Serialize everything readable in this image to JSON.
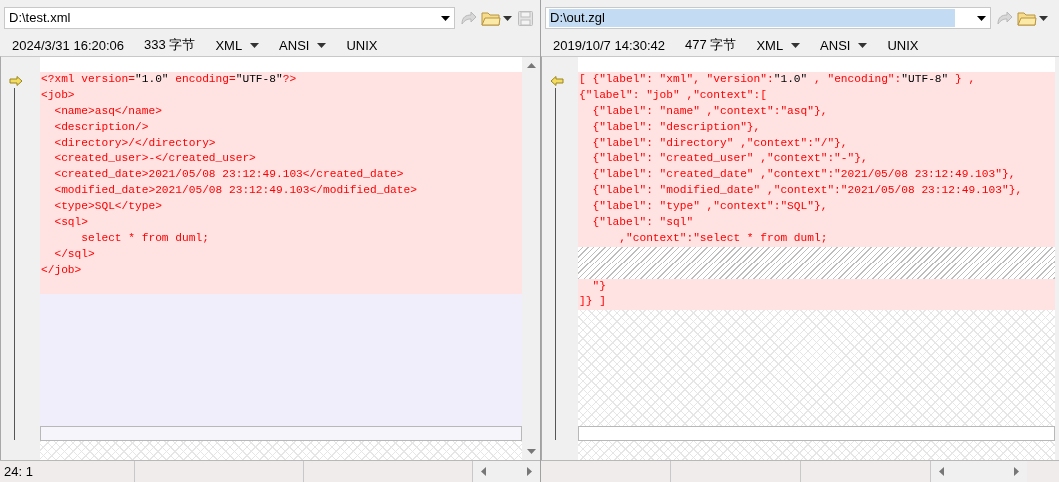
{
  "panes": [
    {
      "path": {
        "value": "D:\\test.xml",
        "selected": false
      },
      "info": {
        "date": "2024/3/31 16:20:06",
        "size": "333 字节",
        "syntax": "XML",
        "encoding": "ANSI",
        "eol": "UNIX"
      },
      "rows": [
        {
          "kind": "text",
          "segments": [
            {
              "text": "<?xml version=",
              "diff": true
            },
            {
              "text": "\"1.0\"",
              "diff": false
            },
            {
              "text": " encoding=",
              "diff": true
            },
            {
              "text": "\"UTF-8\"",
              "diff": false
            },
            {
              "text": "?>",
              "diff": true
            }
          ]
        },
        {
          "kind": "text",
          "text": "<job>"
        },
        {
          "kind": "text",
          "text": "  <name>asq</name>"
        },
        {
          "kind": "text",
          "text": "  <description/>"
        },
        {
          "kind": "text",
          "text": "  <directory>/</directory>"
        },
        {
          "kind": "text",
          "text": "  <created_user>-</created_user>"
        },
        {
          "kind": "text",
          "text": "  <created_date>2021/05/08 23:12:49.103</created_date>"
        },
        {
          "kind": "text",
          "text": "  <modified_date>2021/05/08 23:12:49.103</modified_date>"
        },
        {
          "kind": "text",
          "text": "  <type>SQL</type>"
        },
        {
          "kind": "text",
          "text": "  <sql>"
        },
        {
          "kind": "text",
          "text": "      select * from duml;"
        },
        {
          "kind": "text",
          "text": "  </sql>"
        },
        {
          "kind": "text",
          "text": "</job>"
        },
        {
          "kind": "empty"
        }
      ],
      "trailing": {
        "kind": "empty"
      },
      "status": "24: 1"
    },
    {
      "path": {
        "value": "D:\\out.zgl",
        "selected": true
      },
      "info": {
        "date": "2019/10/7 14:30:42",
        "size": "477 字节",
        "syntax": "XML",
        "encoding": "ANSI",
        "eol": "UNIX"
      },
      "rows": [
        {
          "kind": "text",
          "segments": [
            {
              "text": "[ {\"label\": \"xml\", \"version\":",
              "diff": true
            },
            {
              "text": "\"1.0\"",
              "diff": false
            },
            {
              "text": " , \"encoding\":",
              "diff": true
            },
            {
              "text": "\"UTF-8\"",
              "diff": false
            },
            {
              "text": " } ,",
              "diff": true
            }
          ]
        },
        {
          "kind": "text",
          "text": "{\"label\": \"job\" ,\"context\":["
        },
        {
          "kind": "text",
          "text": "  {\"label\": \"name\" ,\"context\":\"asq\"},"
        },
        {
          "kind": "text",
          "text": "  {\"label\": \"description\"},"
        },
        {
          "kind": "text",
          "text": "  {\"label\": \"directory\" ,\"context\":\"/\"},"
        },
        {
          "kind": "text",
          "text": "  {\"label\": \"created_user\" ,\"context\":\"-\"},"
        },
        {
          "kind": "text",
          "text": "  {\"label\": \"created_date\" ,\"context\":\"2021/05/08 23:12:49.103\"},"
        },
        {
          "kind": "text",
          "text": "  {\"label\": \"modified_date\" ,\"context\":\"2021/05/08 23:12:49.103\"},"
        },
        {
          "kind": "text",
          "text": "  {\"label\": \"type\" ,\"context\":\"SQL\"},"
        },
        {
          "kind": "text",
          "text": "  {\"label\": \"sql\""
        },
        {
          "kind": "text",
          "text": "      ,\"context\":\"select * from duml;"
        },
        {
          "kind": "missing"
        },
        {
          "kind": "missing"
        },
        {
          "kind": "text",
          "text": "  \"}"
        },
        {
          "kind": "text",
          "text": "]} ]"
        }
      ],
      "trailing": {
        "kind": "missing"
      }
    }
  ]
}
